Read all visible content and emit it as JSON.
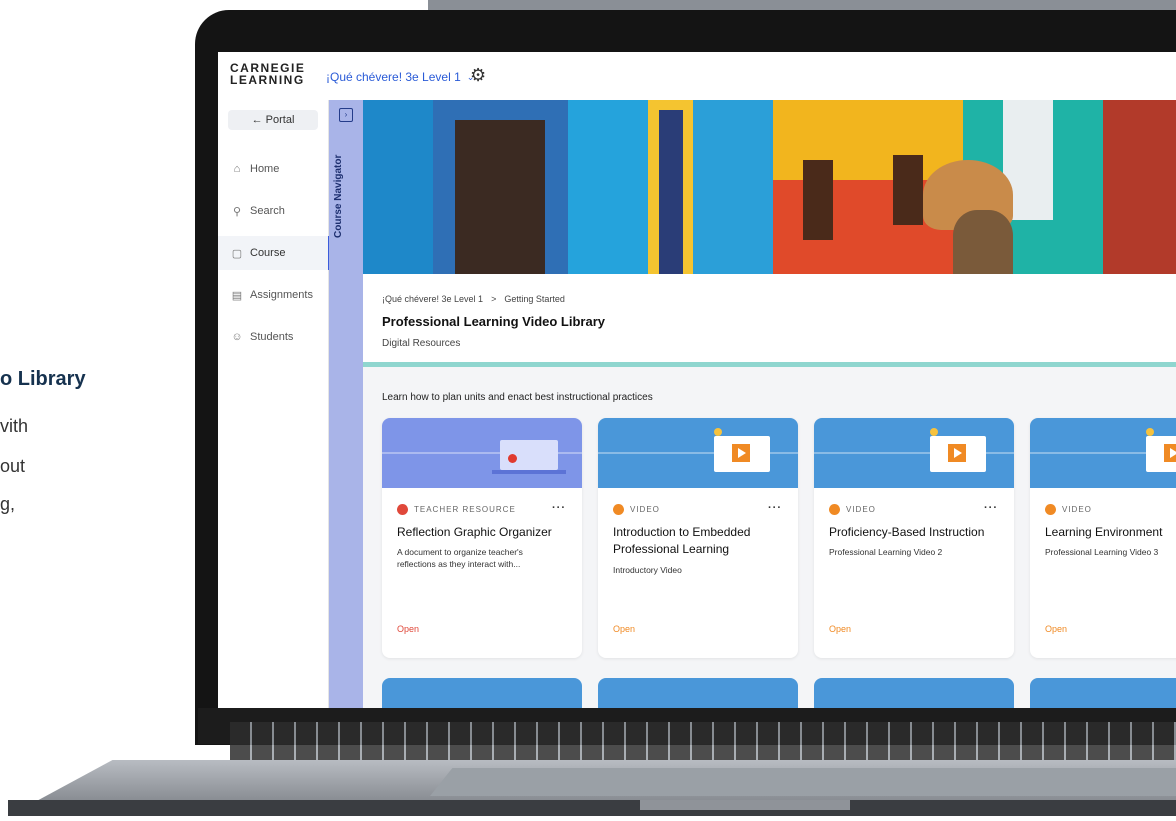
{
  "promo": {
    "title_fragment": "o Library",
    "line1": "vith",
    "line2": "out",
    "line3": "g,"
  },
  "app": {
    "logo_line1": "CARNEGIE",
    "logo_line2": "LEARNING",
    "course_selector": "¡Qué chévere! 3e Level 1",
    "settings_icon": "gear-icon"
  },
  "sidebar": {
    "portal_label": "← Portal",
    "items": [
      {
        "label": "Home",
        "icon": "home-icon",
        "glyph": "⌂"
      },
      {
        "label": "Search",
        "icon": "search-icon",
        "glyph": "⚲"
      },
      {
        "label": "Course",
        "icon": "course-icon",
        "glyph": "▢",
        "active": true
      },
      {
        "label": "Assignments",
        "icon": "assignments-icon",
        "glyph": "▤"
      },
      {
        "label": "Students",
        "icon": "students-icon",
        "glyph": "☺"
      }
    ]
  },
  "navigator": {
    "label": "Course Navigator"
  },
  "page": {
    "breadcrumb_root": "¡Qué chévere! 3e Level 1",
    "breadcrumb_separator": ">",
    "breadcrumb_current": "Getting Started",
    "title": "Professional Learning Video Library",
    "subtitle": "Digital Resources",
    "intro": "Learn how to plan units and enact best instructional practices"
  },
  "cards": [
    {
      "type": "TEACHER RESOURCE",
      "title": "Reflection Graphic Organizer",
      "description": "A document to organize teacher's reflections as they interact with...",
      "action": "Open"
    },
    {
      "type": "VIDEO",
      "title": "Introduction to Embedded Professional Learning",
      "description": "Introductory Video",
      "action": "Open"
    },
    {
      "type": "VIDEO",
      "title": "Proficiency-Based Instruction",
      "description": "Professional Learning Video 2",
      "action": "Open"
    },
    {
      "type": "VIDEO",
      "title": "Learning Environment",
      "description": "Professional Learning Video 3",
      "action": "Open"
    }
  ],
  "colors": {
    "accent": "#3b5bdb",
    "navigator": "#a9b4e8",
    "teal_divider": "#8fd6cf",
    "video_orange": "#f08a24",
    "teacher_red": "#e0483a"
  }
}
